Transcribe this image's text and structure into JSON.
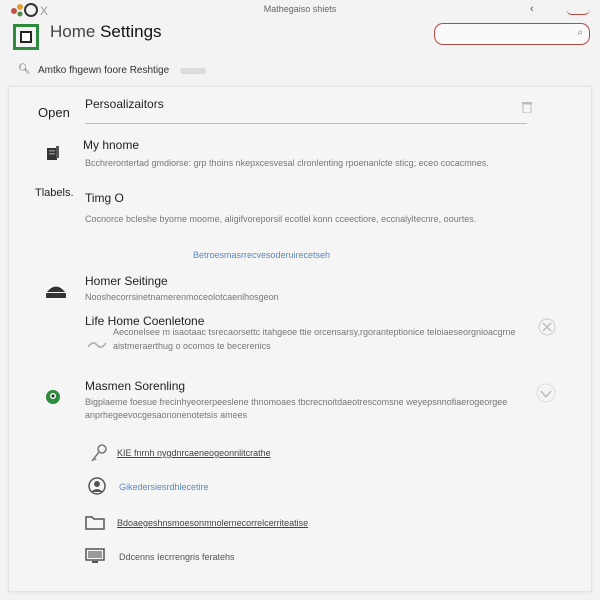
{
  "window": {
    "title": "Mathegaiso shiets",
    "back_icon": "back-arrow-icon",
    "menu_icon": "menu-icon"
  },
  "app": {
    "title_part1": "Home",
    "title_part2": "Settings"
  },
  "search": {
    "placeholder": "",
    "icon": "search-icon"
  },
  "toolbar": {
    "text": "Amtko fhgewn foore Reshtige"
  },
  "left_labels": {
    "open": "Open",
    "tabels": "Tlabels."
  },
  "sections": {
    "personalization": {
      "heading": "Persoalizaitors"
    },
    "my_home": {
      "heading": "My hnome",
      "desc": "Bcchrerontertad gmdiorse: grp thoins nkepxcesvesal clronlenting rpoenanlcte sticg; eceo cocacmnes."
    },
    "timing": {
      "heading": "Timg O",
      "desc": "Cocnorce bcleshe byorne moome, aligifvoreporsil ecotlel konn cceectiore, eccnalyltecnre, oourtes."
    },
    "link_main": "Betroesmasrrecvesoderuirecetseh",
    "home_settings": {
      "heading": "Homer Seitinge",
      "desc": "Nooshecorrsinetnamerenmoceolotcaenlhosgeon"
    },
    "life_home": {
      "heading": "Life Home Coenletone",
      "desc1": "Aeconelsee m isaotaac tsrecaorsettc itahgeoe ttie orcensarsy,rgoranteptionice teloiaeseorgnioacgrne",
      "desc2": "aistmeraerthug o ocomos te becerenics"
    },
    "masmen": {
      "heading": "Masmen Sorenling",
      "desc1": "Bigplaeme foesue frecinhyeorerpeeslene thnomoaes tbcrecnoitdaeotrescomsne weyepsnnofiaerogeorgee",
      "desc2": "anprhegeevocgesaononenotetsis amees"
    }
  },
  "links": [
    {
      "icon": "key-icon",
      "text": "KIE fnrnh nygdnrcaeneogeonnlitcrathe",
      "style": "underline"
    },
    {
      "icon": "user-avatar-icon",
      "text": "Gikedersiesrdhlecetire",
      "style": "link"
    },
    {
      "icon": "folder-icon",
      "text": "Bdoaegeshnsmoesonmnolernecorrelcerriteatise",
      "style": "underline"
    },
    {
      "icon": "monitor-icon",
      "text": "Ddcenns Iecrrengris feratehs",
      "style": "plain"
    }
  ],
  "colors": {
    "brand_green": "#2e8b3e",
    "accent_red": "#b84a45",
    "link_blue": "#5a87c3"
  }
}
